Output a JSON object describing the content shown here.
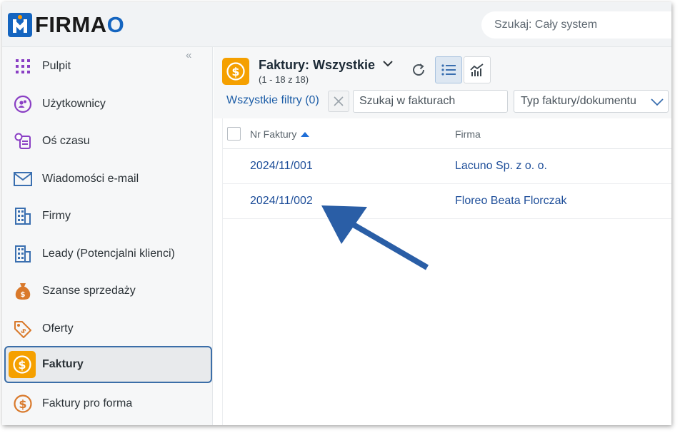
{
  "app": {
    "brand": "FIRMA",
    "brand_o": "O"
  },
  "search": {
    "placeholder": "Szukaj: Cały system"
  },
  "sidebar": {
    "collapse_glyph": "«",
    "items": [
      {
        "label": "Pulpit",
        "icon": "grid-icon"
      },
      {
        "label": "Użytkownicy",
        "icon": "users-icon"
      },
      {
        "label": "Oś czasu",
        "icon": "timeline-icon"
      },
      {
        "label": "Wiadomości e-mail",
        "icon": "mail-icon"
      },
      {
        "label": "Firmy",
        "icon": "building-icon"
      },
      {
        "label": "Leady (Potencjalni klienci)",
        "icon": "building-icon"
      },
      {
        "label": "Szanse sprzedaży",
        "icon": "money-bag-icon"
      },
      {
        "label": "Oferty",
        "icon": "tag-icon"
      },
      {
        "label": "Faktury",
        "icon": "dollar-coin-icon",
        "active": true
      },
      {
        "label": "Faktury pro forma",
        "icon": "dollar-coin-icon"
      }
    ]
  },
  "main": {
    "view_title": "Faktury: Wszystkie",
    "view_count": "(1 - 18 z 18)",
    "filters_link": "Wszystkie filtry (0)",
    "search_placeholder": "Szukaj w fakturach",
    "type_select": "Typ faktury/dokumentu",
    "columns": {
      "nr": "Nr Faktury",
      "firma": "Firma"
    },
    "rows": [
      {
        "nr": "2024/11/001",
        "firma": "Lacuno Sp. z o. o."
      },
      {
        "nr": "2024/11/002",
        "firma": "Floreo Beata Florczak"
      }
    ]
  },
  "colors": {
    "accent": "#1565c0",
    "orange": "#f5a000",
    "link": "#1f4f9a",
    "arrow": "#2a5ea6"
  }
}
